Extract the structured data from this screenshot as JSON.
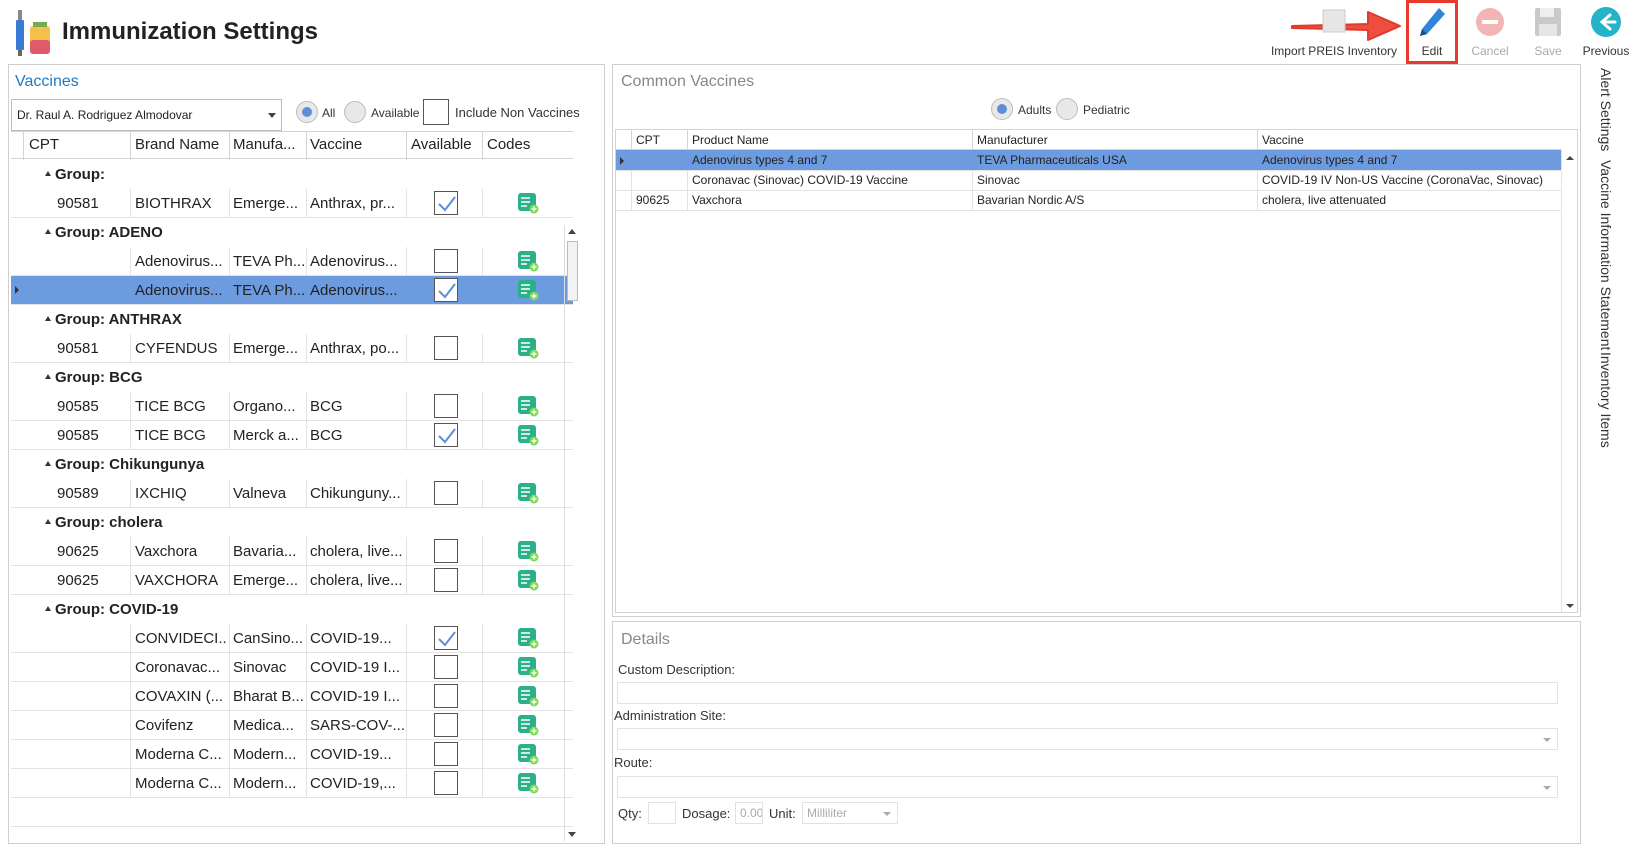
{
  "window": {
    "title": "Immunization Settings"
  },
  "toolbar": {
    "import_label": "Import PREIS Inventory",
    "edit_label": "Edit",
    "cancel_label": "Cancel",
    "save_label": "Save",
    "previous_label": "Previous"
  },
  "vaccines": {
    "title": "Vaccines",
    "provider": "Dr. Raul A. Rodriguez Almodovar",
    "filter_all": "All",
    "filter_available": "Available",
    "include_non": "Include Non Vaccines",
    "columns": [
      "CPT",
      "Brand Name",
      "Manufa...",
      "Vaccine",
      "Available",
      "Codes"
    ],
    "groups": [
      {
        "label": "Group:",
        "rows": [
          {
            "cpt": "90581",
            "brand": "BIOTHRAX",
            "mfr": "Emerge...",
            "vaccine": "Anthrax, pr...",
            "available": true
          }
        ]
      },
      {
        "label": "Group: ADENO",
        "rows": [
          {
            "cpt": "",
            "brand": "Adenovirus...",
            "mfr": "TEVA Ph...",
            "vaccine": "Adenovirus...",
            "available": false
          },
          {
            "cpt": "",
            "brand": "Adenovirus...",
            "mfr": "TEVA Ph...",
            "vaccine": "Adenovirus...",
            "available": true,
            "selected": true
          }
        ]
      },
      {
        "label": "Group: ANTHRAX",
        "rows": [
          {
            "cpt": "90581",
            "brand": "CYFENDUS",
            "mfr": "Emerge...",
            "vaccine": "Anthrax, po...",
            "available": false
          }
        ]
      },
      {
        "label": "Group: BCG",
        "rows": [
          {
            "cpt": "90585",
            "brand": "TICE BCG",
            "mfr": "Organo...",
            "vaccine": "BCG",
            "available": false
          },
          {
            "cpt": "90585",
            "brand": "TICE BCG",
            "mfr": "Merck a...",
            "vaccine": "BCG",
            "available": true
          }
        ]
      },
      {
        "label": "Group: Chikungunya",
        "rows": [
          {
            "cpt": "90589",
            "brand": "IXCHIQ",
            "mfr": "Valneva",
            "vaccine": "Chikunguny...",
            "available": false
          }
        ]
      },
      {
        "label": "Group: cholera",
        "rows": [
          {
            "cpt": "90625",
            "brand": "Vaxchora",
            "mfr": "Bavaria...",
            "vaccine": "cholera, live...",
            "available": false
          },
          {
            "cpt": "90625",
            "brand": "VAXCHORA",
            "mfr": "Emerge...",
            "vaccine": "cholera, live...",
            "available": false
          }
        ]
      },
      {
        "label": "Group: COVID-19",
        "rows": [
          {
            "cpt": "",
            "brand": "CONVIDECI...",
            "mfr": "CanSino...",
            "vaccine": "COVID-19...",
            "available": true
          },
          {
            "cpt": "",
            "brand": "Coronavac...",
            "mfr": "Sinovac",
            "vaccine": "COVID-19 I...",
            "available": false
          },
          {
            "cpt": "",
            "brand": "COVAXIN (...",
            "mfr": "Bharat B...",
            "vaccine": "COVID-19 I...",
            "available": false
          },
          {
            "cpt": "",
            "brand": "Covifenz",
            "mfr": "Medica...",
            "vaccine": "SARS-COV-...",
            "available": false
          },
          {
            "cpt": "",
            "brand": "Moderna C...",
            "mfr": "Modern...",
            "vaccine": "COVID-19...",
            "available": false
          },
          {
            "cpt": "",
            "brand": "Moderna C...",
            "mfr": "Modern...",
            "vaccine": "COVID-19,...",
            "available": false
          }
        ]
      }
    ]
  },
  "common": {
    "title": "Common Vaccines",
    "adults": "Adults",
    "pediatric": "Pediatric",
    "columns": [
      "CPT",
      "Product Name",
      "Manufacturer",
      "Vaccine"
    ],
    "rows": [
      {
        "cpt": "",
        "product": "Adenovirus types 4 and 7",
        "mfr": "TEVA Pharmaceuticals USA",
        "vaccine": "Adenovirus types 4 and 7",
        "selected": true
      },
      {
        "cpt": "",
        "product": "Coronavac (Sinovac) COVID-19 Vaccine",
        "mfr": "Sinovac",
        "vaccine": "COVID-19 IV Non-US Vaccine (CoronaVac, Sinovac)"
      },
      {
        "cpt": "90625",
        "product": "Vaxchora",
        "mfr": "Bavarian Nordic A/S",
        "vaccine": "cholera, live attenuated"
      }
    ]
  },
  "details": {
    "title": "Details",
    "custom_desc_label": "Custom Description:",
    "admin_site_label": "Administration Site:",
    "route_label": "Route:",
    "qty_label": "Qty:",
    "dosage_label": "Dosage:",
    "dosage_value": "0.00",
    "unit_label": "Unit:",
    "unit_value": "Milliliter"
  },
  "side_tabs": [
    "Alert Settings",
    "Vaccine Information Statement",
    "Inventory Items"
  ],
  "colors": {
    "accent": "#1e7ac4",
    "selection": "#6d9be0",
    "highlight": "#e8392b",
    "codes_icon": "#2bb08a"
  }
}
